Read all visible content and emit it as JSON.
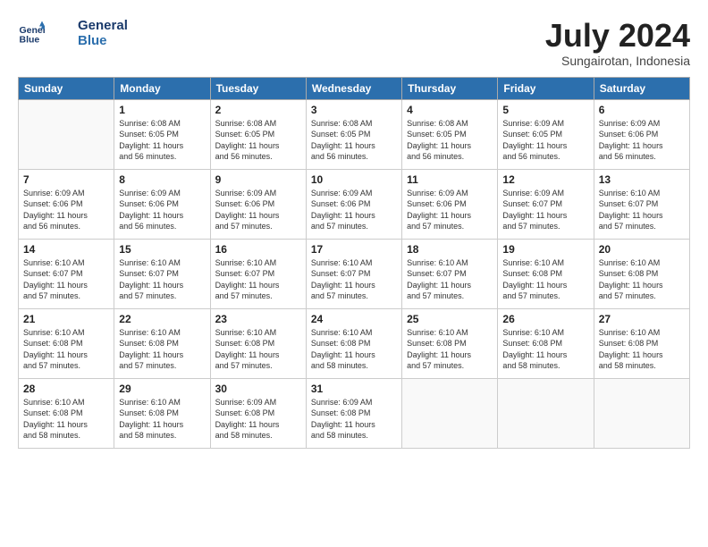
{
  "logo": {
    "line1": "General",
    "line2": "Blue"
  },
  "title": "July 2024",
  "subtitle": "Sungairotan, Indonesia",
  "days_of_week": [
    "Sunday",
    "Monday",
    "Tuesday",
    "Wednesday",
    "Thursday",
    "Friday",
    "Saturday"
  ],
  "weeks": [
    [
      {
        "day": "",
        "info": ""
      },
      {
        "day": "1",
        "info": "Sunrise: 6:08 AM\nSunset: 6:05 PM\nDaylight: 11 hours\nand 56 minutes."
      },
      {
        "day": "2",
        "info": "Sunrise: 6:08 AM\nSunset: 6:05 PM\nDaylight: 11 hours\nand 56 minutes."
      },
      {
        "day": "3",
        "info": "Sunrise: 6:08 AM\nSunset: 6:05 PM\nDaylight: 11 hours\nand 56 minutes."
      },
      {
        "day": "4",
        "info": "Sunrise: 6:08 AM\nSunset: 6:05 PM\nDaylight: 11 hours\nand 56 minutes."
      },
      {
        "day": "5",
        "info": "Sunrise: 6:09 AM\nSunset: 6:05 PM\nDaylight: 11 hours\nand 56 minutes."
      },
      {
        "day": "6",
        "info": "Sunrise: 6:09 AM\nSunset: 6:06 PM\nDaylight: 11 hours\nand 56 minutes."
      }
    ],
    [
      {
        "day": "7",
        "info": "Sunrise: 6:09 AM\nSunset: 6:06 PM\nDaylight: 11 hours\nand 56 minutes."
      },
      {
        "day": "8",
        "info": "Sunrise: 6:09 AM\nSunset: 6:06 PM\nDaylight: 11 hours\nand 56 minutes."
      },
      {
        "day": "9",
        "info": "Sunrise: 6:09 AM\nSunset: 6:06 PM\nDaylight: 11 hours\nand 57 minutes."
      },
      {
        "day": "10",
        "info": "Sunrise: 6:09 AM\nSunset: 6:06 PM\nDaylight: 11 hours\nand 57 minutes."
      },
      {
        "day": "11",
        "info": "Sunrise: 6:09 AM\nSunset: 6:06 PM\nDaylight: 11 hours\nand 57 minutes."
      },
      {
        "day": "12",
        "info": "Sunrise: 6:09 AM\nSunset: 6:07 PM\nDaylight: 11 hours\nand 57 minutes."
      },
      {
        "day": "13",
        "info": "Sunrise: 6:10 AM\nSunset: 6:07 PM\nDaylight: 11 hours\nand 57 minutes."
      }
    ],
    [
      {
        "day": "14",
        "info": "Sunrise: 6:10 AM\nSunset: 6:07 PM\nDaylight: 11 hours\nand 57 minutes."
      },
      {
        "day": "15",
        "info": "Sunrise: 6:10 AM\nSunset: 6:07 PM\nDaylight: 11 hours\nand 57 minutes."
      },
      {
        "day": "16",
        "info": "Sunrise: 6:10 AM\nSunset: 6:07 PM\nDaylight: 11 hours\nand 57 minutes."
      },
      {
        "day": "17",
        "info": "Sunrise: 6:10 AM\nSunset: 6:07 PM\nDaylight: 11 hours\nand 57 minutes."
      },
      {
        "day": "18",
        "info": "Sunrise: 6:10 AM\nSunset: 6:07 PM\nDaylight: 11 hours\nand 57 minutes."
      },
      {
        "day": "19",
        "info": "Sunrise: 6:10 AM\nSunset: 6:08 PM\nDaylight: 11 hours\nand 57 minutes."
      },
      {
        "day": "20",
        "info": "Sunrise: 6:10 AM\nSunset: 6:08 PM\nDaylight: 11 hours\nand 57 minutes."
      }
    ],
    [
      {
        "day": "21",
        "info": "Sunrise: 6:10 AM\nSunset: 6:08 PM\nDaylight: 11 hours\nand 57 minutes."
      },
      {
        "day": "22",
        "info": "Sunrise: 6:10 AM\nSunset: 6:08 PM\nDaylight: 11 hours\nand 57 minutes."
      },
      {
        "day": "23",
        "info": "Sunrise: 6:10 AM\nSunset: 6:08 PM\nDaylight: 11 hours\nand 57 minutes."
      },
      {
        "day": "24",
        "info": "Sunrise: 6:10 AM\nSunset: 6:08 PM\nDaylight: 11 hours\nand 58 minutes."
      },
      {
        "day": "25",
        "info": "Sunrise: 6:10 AM\nSunset: 6:08 PM\nDaylight: 11 hours\nand 57 minutes."
      },
      {
        "day": "26",
        "info": "Sunrise: 6:10 AM\nSunset: 6:08 PM\nDaylight: 11 hours\nand 58 minutes."
      },
      {
        "day": "27",
        "info": "Sunrise: 6:10 AM\nSunset: 6:08 PM\nDaylight: 11 hours\nand 58 minutes."
      }
    ],
    [
      {
        "day": "28",
        "info": "Sunrise: 6:10 AM\nSunset: 6:08 PM\nDaylight: 11 hours\nand 58 minutes."
      },
      {
        "day": "29",
        "info": "Sunrise: 6:10 AM\nSunset: 6:08 PM\nDaylight: 11 hours\nand 58 minutes."
      },
      {
        "day": "30",
        "info": "Sunrise: 6:09 AM\nSunset: 6:08 PM\nDaylight: 11 hours\nand 58 minutes."
      },
      {
        "day": "31",
        "info": "Sunrise: 6:09 AM\nSunset: 6:08 PM\nDaylight: 11 hours\nand 58 minutes."
      },
      {
        "day": "",
        "info": ""
      },
      {
        "day": "",
        "info": ""
      },
      {
        "day": "",
        "info": ""
      }
    ]
  ]
}
